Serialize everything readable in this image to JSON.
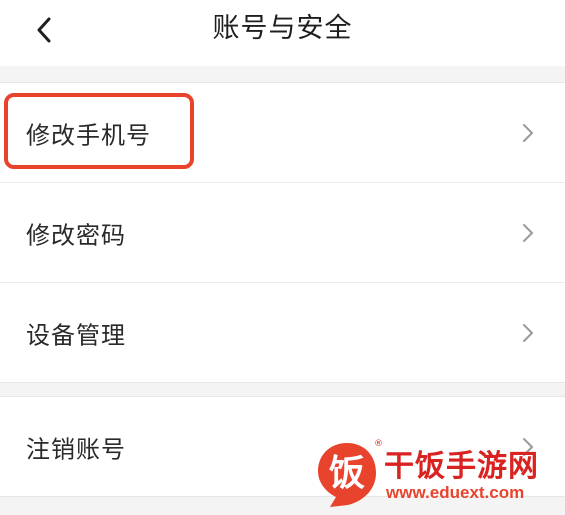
{
  "header": {
    "title": "账号与安全",
    "back_icon": "chevron-left-icon"
  },
  "groups": [
    {
      "items": [
        {
          "label": "修改手机号",
          "icon": "chevron-right-icon",
          "highlighted": true
        },
        {
          "label": "修改密码",
          "icon": "chevron-right-icon"
        },
        {
          "label": "设备管理",
          "icon": "chevron-right-icon"
        }
      ]
    },
    {
      "items": [
        {
          "label": "注销账号",
          "icon": "chevron-right-icon"
        }
      ]
    }
  ],
  "watermark": {
    "logo_char": "饭",
    "site_name": "干饭手游网",
    "url": "www.eduext.com",
    "registered_mark": "®"
  },
  "colors": {
    "highlight_border": "#e8432d",
    "watermark_red": "#d92321",
    "page_background": "#f4f4f4",
    "row_background": "#ffffff",
    "chevron": "#9a9a9a"
  }
}
